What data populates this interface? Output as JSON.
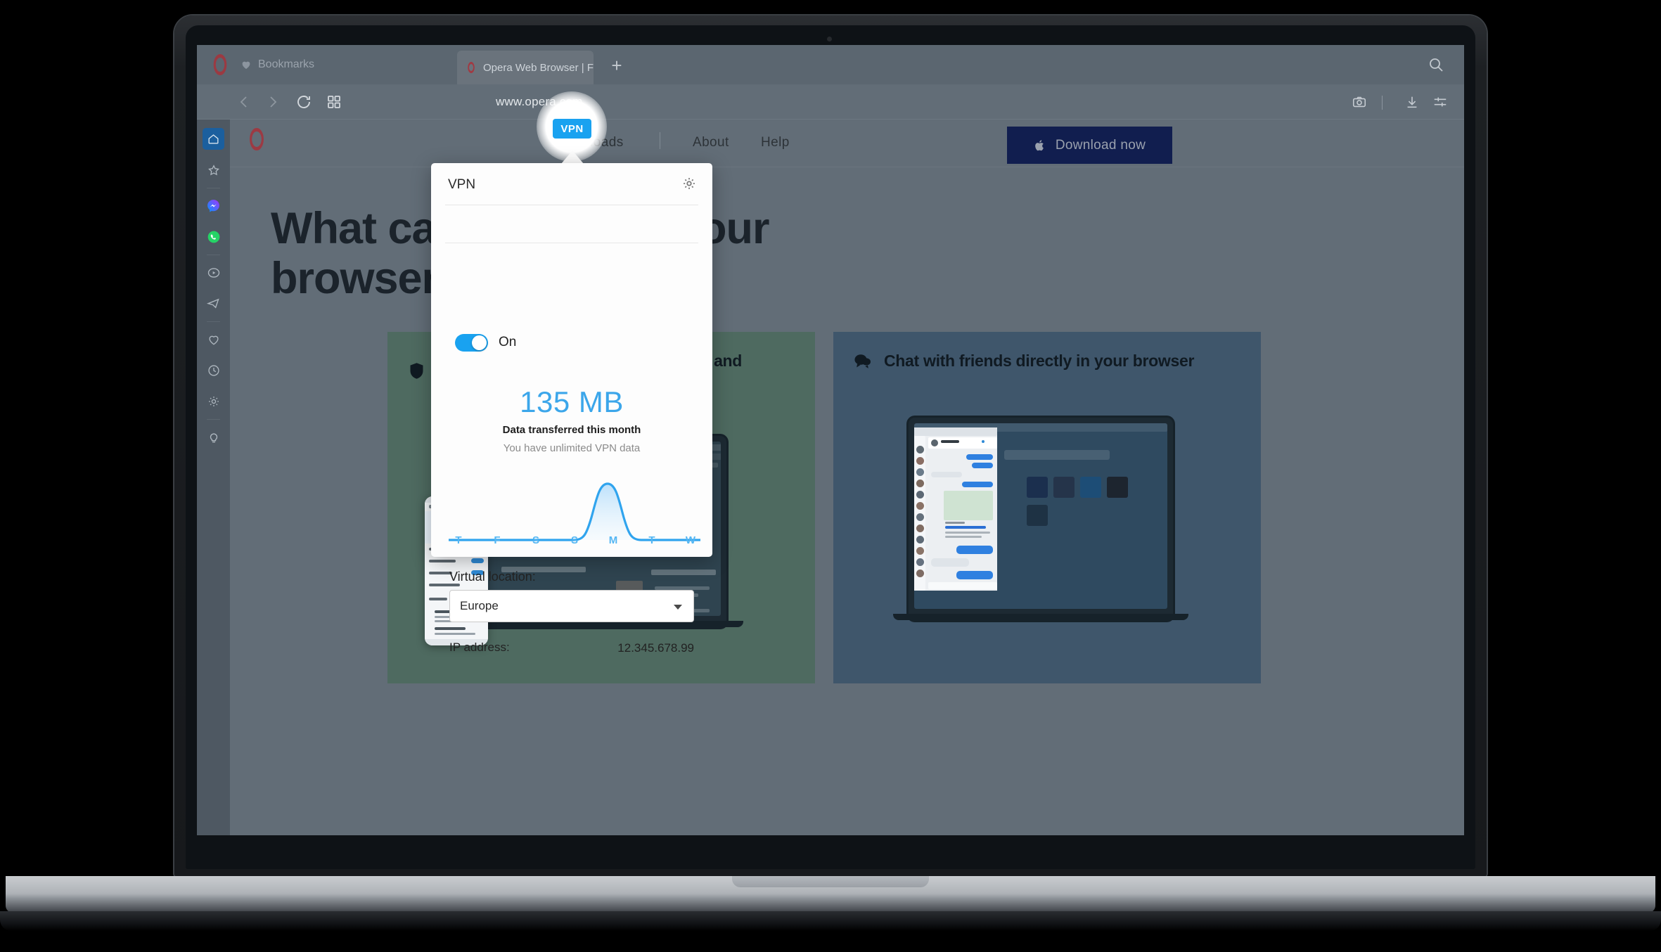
{
  "browser": {
    "bookmarks_label": "Bookmarks",
    "tab_title": "Opera Web Browser | Faster, S",
    "new_tab_label": "+",
    "url": "www.opera.com",
    "vpn_badge_label": "VPN",
    "icons": {
      "opera_logo": "opera-logo-icon",
      "heart": "heart-icon",
      "new_tab": "plus-icon",
      "search": "search-icon",
      "back": "back-arrow-icon",
      "forward": "forward-arrow-icon",
      "reload": "reload-icon",
      "workspaces": "grid-icon",
      "snapshot": "camera-icon",
      "downloads": "download-icon",
      "easy_setup": "sliders-icon"
    },
    "sidebar": [
      {
        "name": "sidebar-item-home",
        "icon": "home-icon",
        "active": true
      },
      {
        "name": "sidebar-item-speed-dial",
        "icon": "star-icon",
        "active": false
      },
      {
        "name": "sidebar-item-messenger",
        "icon": "messenger-icon",
        "active": false
      },
      {
        "name": "sidebar-item-whatsapp",
        "icon": "whatsapp-icon",
        "active": false
      },
      {
        "name": "sidebar-item-player",
        "icon": "play-circle-icon",
        "active": false
      },
      {
        "name": "sidebar-item-telegram",
        "icon": "telegram-icon",
        "active": false
      },
      {
        "name": "sidebar-item-favorites",
        "icon": "heart-icon",
        "active": false
      },
      {
        "name": "sidebar-item-history",
        "icon": "clock-icon",
        "active": false
      },
      {
        "name": "sidebar-item-settings",
        "icon": "gear-icon",
        "active": false
      },
      {
        "name": "sidebar-item-tips",
        "icon": "lightbulb-icon",
        "active": false
      }
    ],
    "sidebar_more_label": "•••"
  },
  "site": {
    "nav": [
      {
        "label": "Downloads"
      },
      {
        "label": "About"
      },
      {
        "label": "Help"
      }
    ],
    "download_button": "Download now",
    "download_button_icon": "apple-logo-icon",
    "hero_title": "What can you do in your browser?",
    "cards": [
      {
        "icon": "shield-icon",
        "title": "Browse faster and ad-free on mobile and desktop",
        "accent": "#4e6a60"
      },
      {
        "icon": "chat-bubble-icon",
        "title": "Chat with friends directly in your browser",
        "accent": "#3f566b"
      }
    ]
  },
  "vpn_popup": {
    "title": "VPN",
    "settings_icon": "gear-icon",
    "toggle_state_label": "On",
    "toggle_on": true,
    "data_amount": "135 MB",
    "data_caption": "Data transferred this month",
    "data_note": "You have unlimited VPN data",
    "virtual_location_label": "Virtual location:",
    "virtual_location_value": "Europe",
    "ip_label": "IP address:",
    "ip_value": "12.345.678.99",
    "accent_color": "#19a2f0",
    "chart_data": {
      "type": "area",
      "title": "",
      "categories": [
        "T",
        "F",
        "S",
        "S",
        "M",
        "T",
        "W"
      ],
      "values": [
        0,
        0,
        0,
        0,
        135,
        0,
        0
      ],
      "xlabel": "",
      "ylabel": "",
      "ylim": [
        0,
        150
      ],
      "grid": false,
      "legend": "none",
      "line_color": "#3ba6ea",
      "fill_color": "#cfe9fb"
    }
  }
}
